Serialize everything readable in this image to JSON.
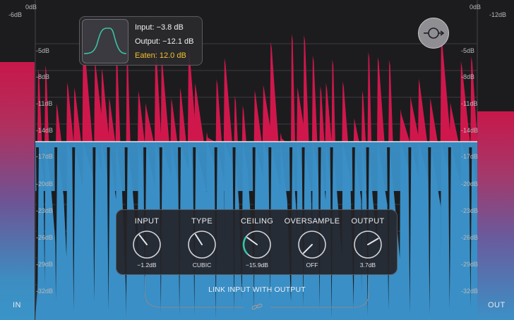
{
  "scale_left": [
    "-6dB"
  ],
  "scale_right_top": [
    "0dB"
  ],
  "scale_right_far": [
    "-12dB"
  ],
  "scale": [
    "-5dB",
    "-8dB",
    "-11dB",
    "-14dB",
    "-17dB",
    "-20dB",
    "-23dB",
    "-26dB",
    "-29dB",
    "-32dB"
  ],
  "scale_top_left": "0dB",
  "meters": {
    "in_label": "IN",
    "out_label": "OUT"
  },
  "tooltip": {
    "input": "Input: −3.8 dB",
    "output": "Output: −12.1 dB",
    "eaten": "Eaten: 12.0 dB",
    "eaten_color": "#f2c12e"
  },
  "controls": [
    {
      "title": "INPUT",
      "value": "−1.2dB",
      "level": 0.36,
      "accent": false
    },
    {
      "title": "TYPE",
      "value": "CUBIC",
      "level": 0.38,
      "accent": false
    },
    {
      "title": "CEILING",
      "value": "−15.9dB",
      "level": 0.3,
      "accent": true
    },
    {
      "title": "OVERSAMPLE",
      "value": "OFF",
      "level": 0.0,
      "accent": false
    },
    {
      "title": "OUTPUT",
      "value": "3.7dB",
      "level": 0.72,
      "accent": false
    }
  ],
  "link": {
    "label": "LINK INPUT WITH OUTPUT"
  },
  "colors": {
    "red": "#d0174c",
    "blue": "#3a8fc6",
    "ceiling_line": "#e6e6e6",
    "knob_accent": "#35c4a4"
  },
  "icons": {
    "bypass": "bypass-loop-icon",
    "link": "chain-link-icon"
  }
}
